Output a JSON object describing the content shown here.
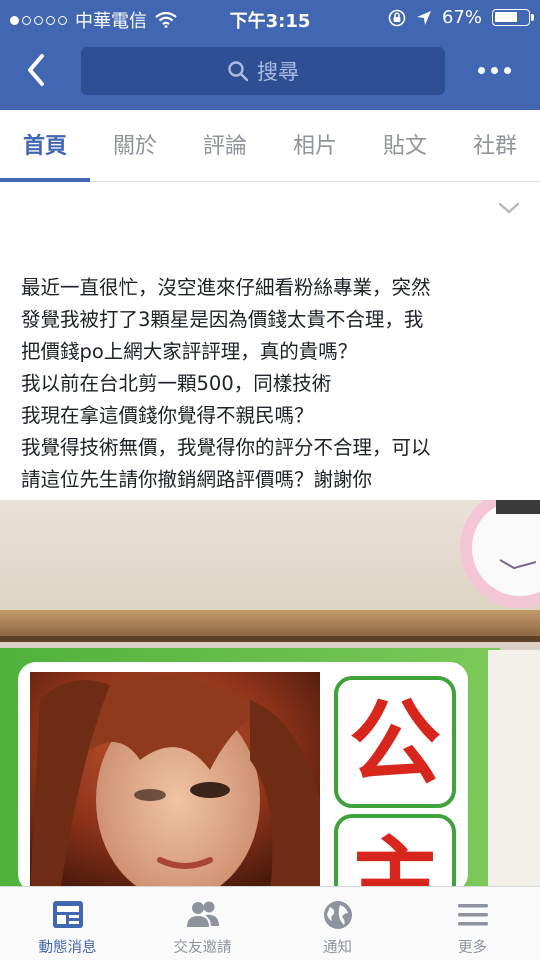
{
  "status_bar": {
    "carrier": "中華電信",
    "time": "下午3:15",
    "battery": "67%",
    "battery_level": 0.67
  },
  "header": {
    "search_placeholder": "搜尋",
    "back_icon": "chevron-left-icon",
    "more_icon": "more-dots-icon"
  },
  "tabs": [
    {
      "label": "首頁",
      "active": true
    },
    {
      "label": "關於",
      "active": false
    },
    {
      "label": "評論",
      "active": false
    },
    {
      "label": "相片",
      "active": false
    },
    {
      "label": "貼文",
      "active": false
    },
    {
      "label": "社群",
      "active": false
    }
  ],
  "post": {
    "lines": [
      "最近一直很忙，沒空進來仔細看粉絲專業，突然",
      "發覺我被打了3顆星是因為價錢太貴不合理，我",
      "把價錢po上網大家評評理，真的貴嗎？",
      "我以前在台北剪一顆500，同樣技術",
      "我現在拿這價錢你覺得不親民嗎？",
      "我覺得技術無價，我覺得你的評分不合理，可以",
      "請這位先生請你撤銷網路評價嗎？謝謝你"
    ]
  },
  "photo": {
    "sign_characters": [
      "公",
      "主"
    ]
  },
  "bottom_nav": [
    {
      "label": "動態消息",
      "icon": "news-feed-icon",
      "active": true
    },
    {
      "label": "交友邀請",
      "icon": "friend-requests-icon",
      "active": false
    },
    {
      "label": "通知",
      "icon": "globe-notifications-icon",
      "active": false
    },
    {
      "label": "更多",
      "icon": "menu-icon",
      "active": false
    }
  ],
  "colors": {
    "brand_blue": "#4267b2",
    "search_bg": "#2f4f94",
    "inactive_gray": "#90949c"
  }
}
